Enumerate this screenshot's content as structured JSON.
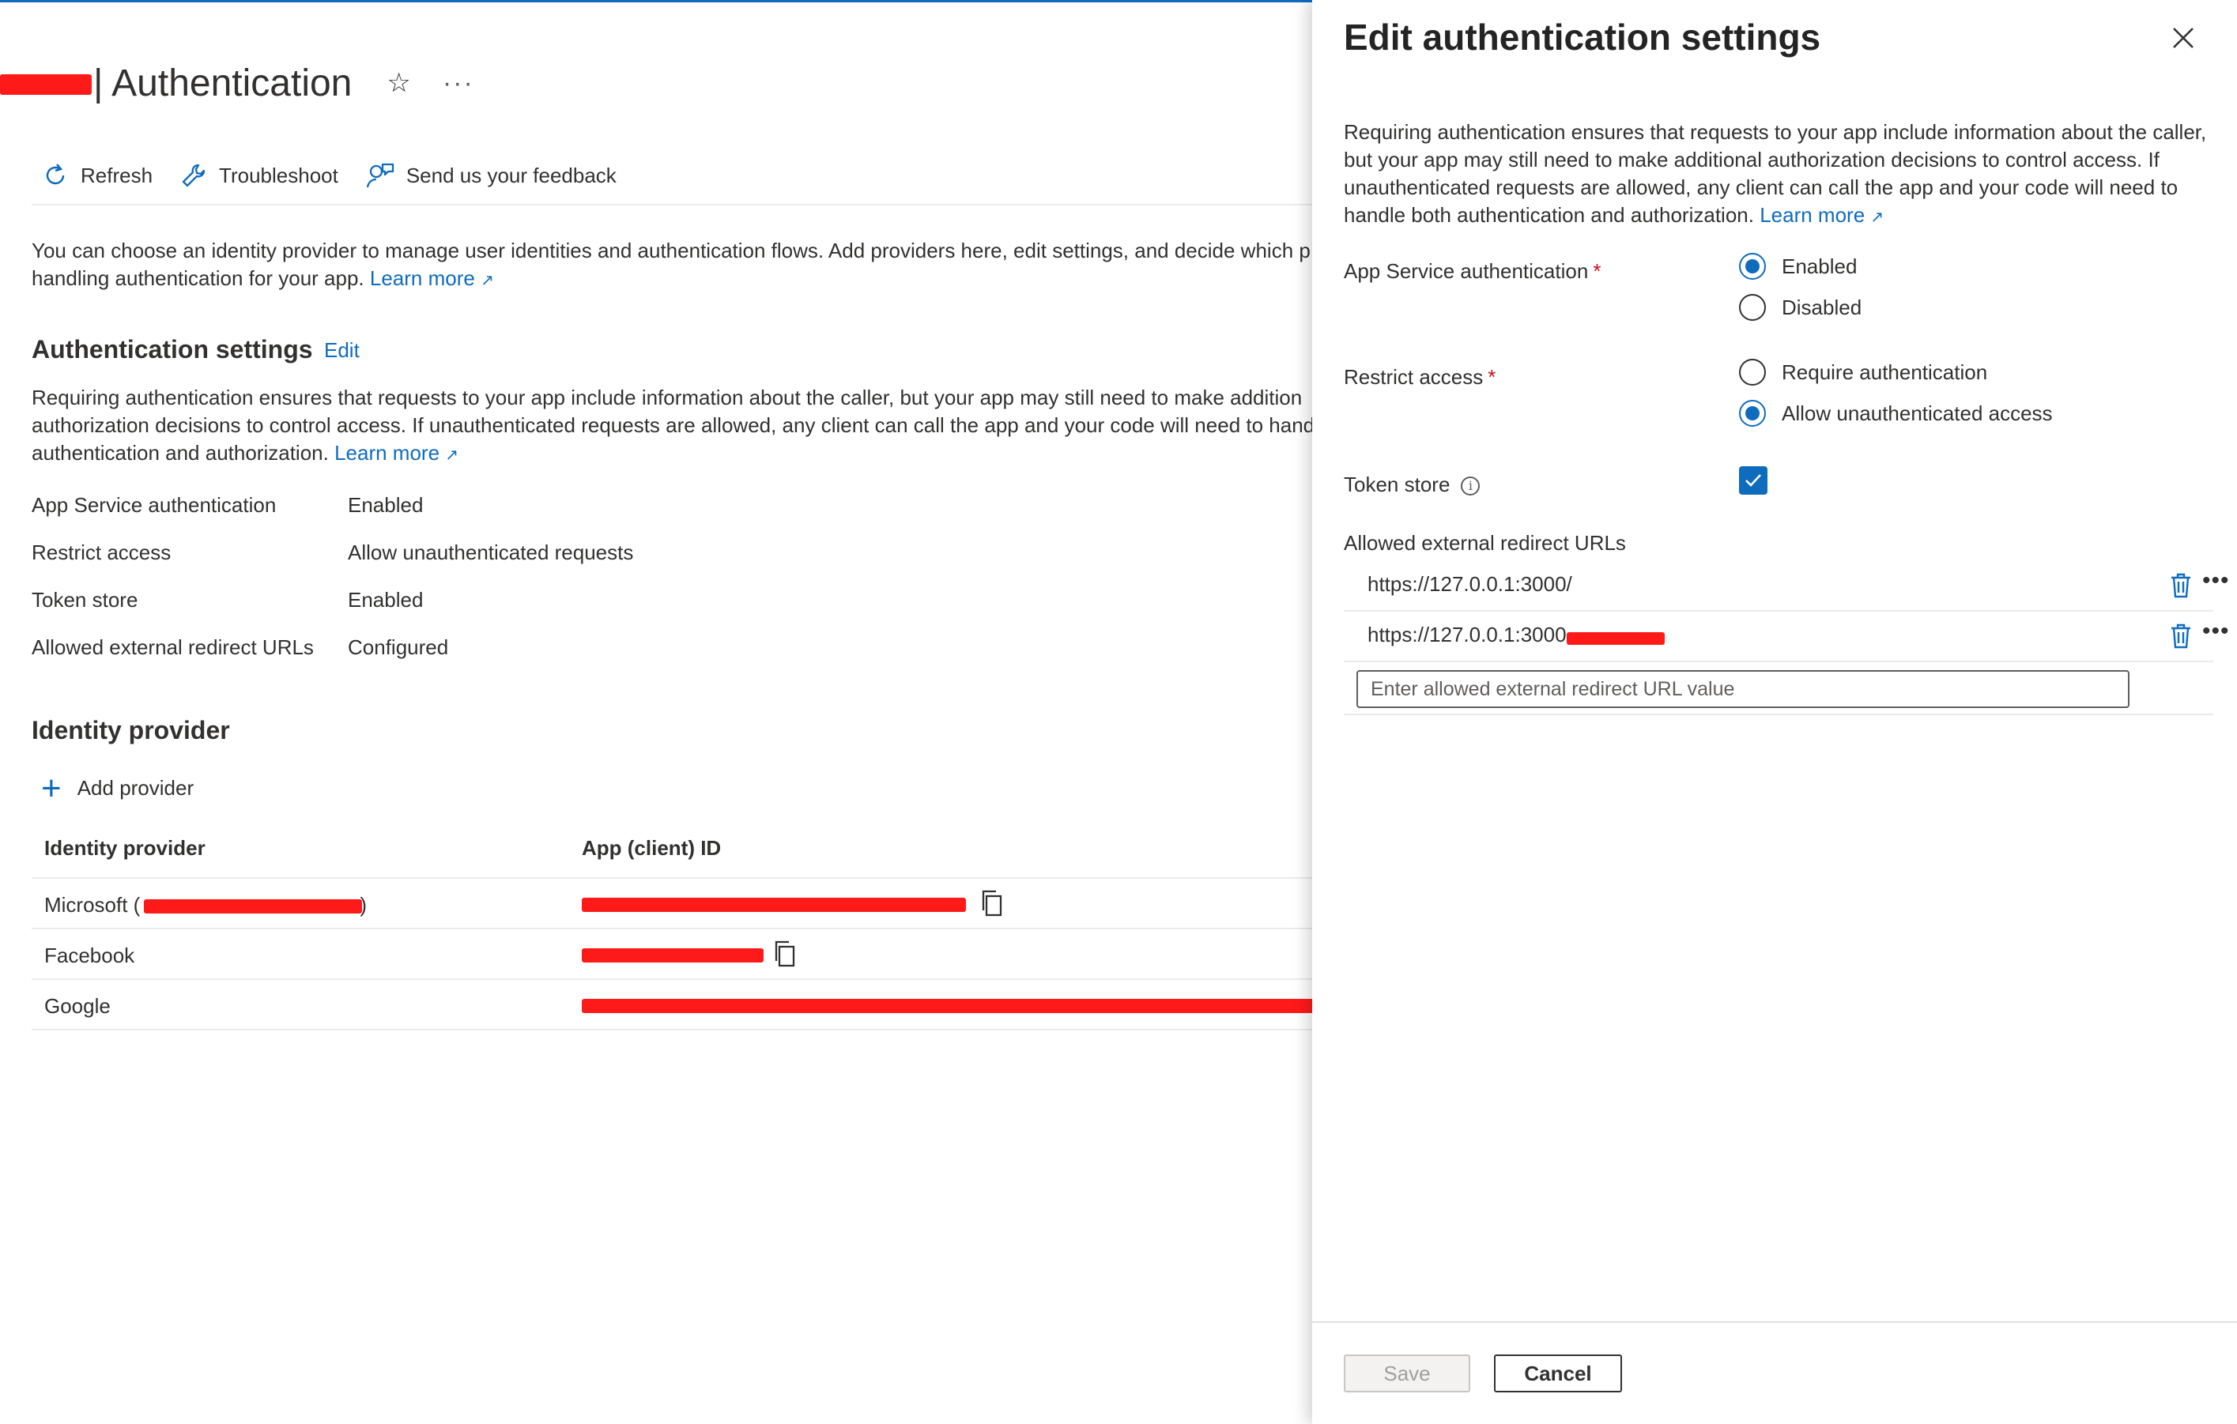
{
  "page": {
    "title": "| Authentication",
    "toolbar": {
      "refresh": "Refresh",
      "troubleshoot": "Troubleshoot",
      "feedback": "Send us your feedback"
    },
    "intro_text": "You can choose an identity provider to manage user identities and authentication flows. Add providers here, edit settings, and decide which p",
    "intro_text_2": "handling authentication for your app.",
    "learn_more": "Learn more",
    "auth_settings": {
      "heading": "Authentication settings",
      "edit": "Edit",
      "desc_1": "Requiring authentication ensures that requests to your app include information about the caller, but your app may still need to make addition",
      "desc_2": "authorization decisions to control access. If unauthenticated requests are allowed, any client can call the app and your code will need to handl",
      "desc_3": "authentication and authorization.",
      "rows": [
        {
          "label": "App Service authentication",
          "value": "Enabled"
        },
        {
          "label": "Restrict access",
          "value": "Allow unauthenticated requests"
        },
        {
          "label": "Token store",
          "value": "Enabled"
        },
        {
          "label": "Allowed external redirect URLs",
          "value": "Configured"
        }
      ]
    },
    "identity": {
      "heading": "Identity provider",
      "add_provider": "Add provider",
      "col_provider": "Identity provider",
      "col_client_id": "App (client) ID",
      "rows": [
        {
          "provider": "Microsoft (",
          "suffix": ")"
        },
        {
          "provider": "Facebook"
        },
        {
          "provider": "Google"
        }
      ]
    }
  },
  "panel": {
    "title": "Edit authentication settings",
    "description": "Requiring authentication ensures that requests to your app include information about the caller, but your app may still need to make additional authorization decisions to control access. If unauthenticated requests are allowed, any client can call the app and your code will need to handle both authentication and authorization.",
    "learn_more": "Learn more",
    "app_service_auth": {
      "label": "App Service authentication",
      "options": [
        "Enabled",
        "Disabled"
      ],
      "selected": "Enabled"
    },
    "restrict_access": {
      "label": "Restrict access",
      "options": [
        "Require authentication",
        "Allow unauthenticated access"
      ],
      "selected": "Allow unauthenticated access"
    },
    "token_store": {
      "label": "Token store",
      "checked": true
    },
    "redirect_urls": {
      "label": "Allowed external redirect URLs",
      "items": [
        "https://127.0.0.1:3000/",
        "https://127.0.0.1:3000"
      ],
      "input_placeholder": "Enter allowed external redirect URL value"
    },
    "save": "Save",
    "cancel": "Cancel"
  },
  "colors": {
    "accent": "#0f6cbd",
    "required": "#c50f1f",
    "redaction": "#ff1a1a"
  }
}
